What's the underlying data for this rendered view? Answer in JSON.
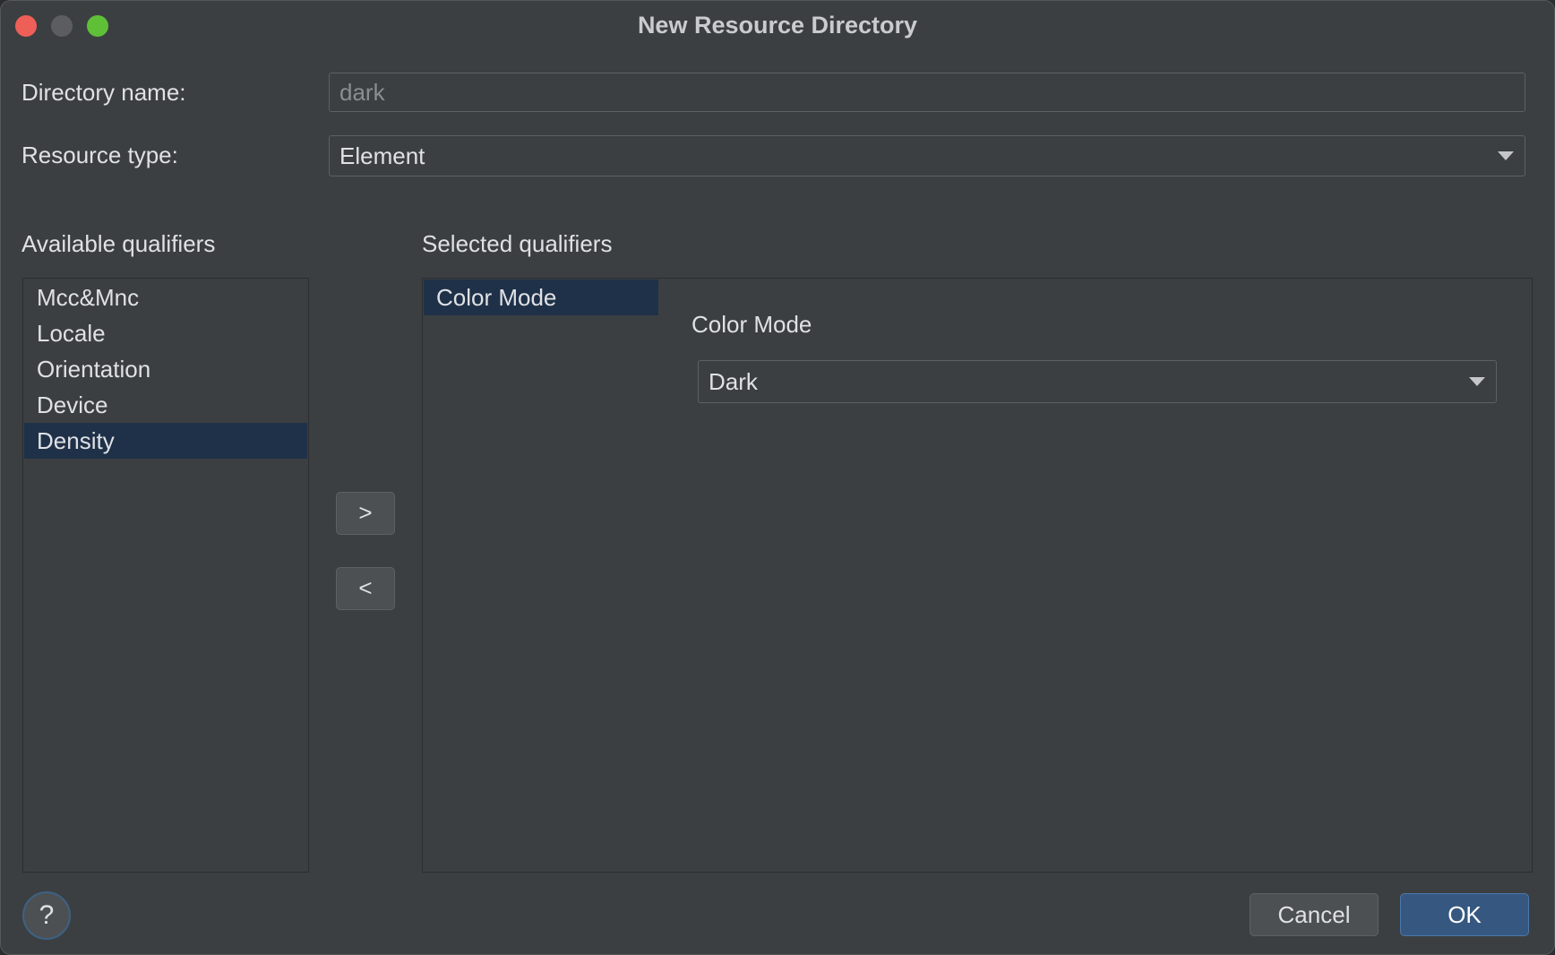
{
  "window": {
    "title": "New Resource Directory"
  },
  "form": {
    "directory_name_label": "Directory name:",
    "directory_name_value": "dark",
    "resource_type_label": "Resource type:",
    "resource_type_value": "Element"
  },
  "available": {
    "heading": "Available qualifiers",
    "items": [
      {
        "label": "Mcc&Mnc"
      },
      {
        "label": "Locale"
      },
      {
        "label": "Orientation"
      },
      {
        "label": "Device"
      },
      {
        "label": "Density"
      }
    ],
    "selected_item": "Density"
  },
  "transfer": {
    "add_label": ">",
    "remove_label": "<"
  },
  "selected": {
    "heading": "Selected qualifiers",
    "items": [
      {
        "label": "Color Mode"
      }
    ]
  },
  "detail": {
    "heading": "Color Mode",
    "value": "Dark"
  },
  "footer": {
    "help_label": "?",
    "cancel_label": "Cancel",
    "ok_label": "OK"
  },
  "colors": {
    "background": "#3c3f41",
    "selection": "#1f3148",
    "primary_button": "#365880",
    "close": "#ee5f57",
    "maximize": "#5fc038"
  },
  "icons": [
    "window-close-icon",
    "window-minimize-icon",
    "window-maximize-icon",
    "dropdown-arrow-icon",
    "help-icon"
  ]
}
